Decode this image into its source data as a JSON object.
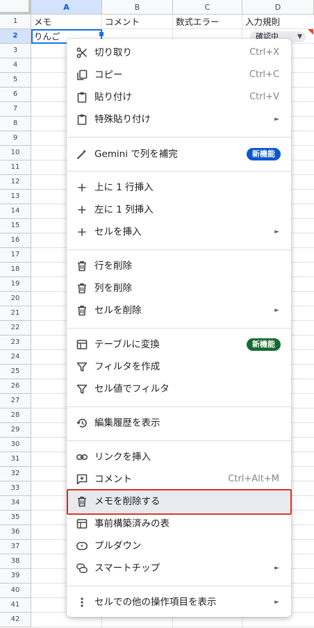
{
  "sheet": {
    "columns": [
      "A",
      "B",
      "C",
      "D"
    ],
    "headers": [
      "メモ",
      "コメント",
      "数式エラー",
      "入力規則"
    ],
    "row_numbers": [
      "1",
      "2",
      "3",
      "4",
      "5",
      "6",
      "7",
      "8",
      "9",
      "10",
      "11",
      "12",
      "13",
      "14",
      "15",
      "16",
      "17",
      "18",
      "19",
      "20",
      "21",
      "22",
      "23",
      "24",
      "25",
      "26",
      "27",
      "28",
      "29",
      "30",
      "31",
      "32",
      "33",
      "34",
      "35",
      "36",
      "37",
      "38",
      "39",
      "40",
      "41",
      "42"
    ],
    "a2": "りんご",
    "d2_chip": "確認中"
  },
  "menu": {
    "cut": {
      "label": "切り取り",
      "shortcut": "Ctrl+X"
    },
    "copy": {
      "label": "コピー",
      "shortcut": "Ctrl+C"
    },
    "paste": {
      "label": "貼り付け",
      "shortcut": "Ctrl+V"
    },
    "paste_special": {
      "label": "特殊貼り付け"
    },
    "gemini": {
      "label": "Gemini で列を補完",
      "badge": "新機能"
    },
    "insert_row": {
      "label": "上に 1 行挿入"
    },
    "insert_col": {
      "label": "左に 1 列挿入"
    },
    "insert_cells": {
      "label": "セルを挿入"
    },
    "delete_row": {
      "label": "行を削除"
    },
    "delete_col": {
      "label": "列を削除"
    },
    "delete_cells": {
      "label": "セルを削除"
    },
    "convert_table": {
      "label": "テーブルに変換",
      "badge": "新機能"
    },
    "create_filter": {
      "label": "フィルタを作成"
    },
    "filter_by_value": {
      "label": "セル値でフィルタ"
    },
    "edit_history": {
      "label": "編集履歴を表示"
    },
    "insert_link": {
      "label": "リンクを挿入"
    },
    "comment": {
      "label": "コメント",
      "shortcut": "Ctrl+Alt+M"
    },
    "delete_note": {
      "label": "メモを削除する"
    },
    "prebuilt_table": {
      "label": "事前構築済みの表"
    },
    "dropdown": {
      "label": "プルダウン"
    },
    "smart_chips": {
      "label": "スマートチップ"
    },
    "more_actions": {
      "label": "セルでの他の操作項目を表示"
    },
    "submenu_arrow": "►"
  },
  "colors": {
    "badge_blue": "#0b57d0",
    "badge_green": "#146c2e",
    "highlight_border": "#d93025",
    "selection_header": "#d3e3fd"
  }
}
